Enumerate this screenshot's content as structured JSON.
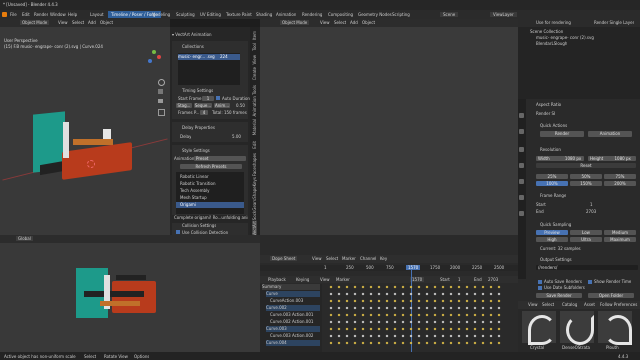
{
  "window": {
    "title": "* [Unsaved] - Blender 4.4.3"
  },
  "menus": [
    "File",
    "Edit",
    "Render",
    "Window",
    "Help"
  ],
  "workspaces": [
    "Layout",
    "Modeling",
    "Sculpting",
    "UV Editing",
    "Texture Paint",
    "Shading",
    "Animation",
    "Rendering",
    "Compositing",
    "Geometry Nodes",
    "Scripting"
  ],
  "active_workspace": "Timeline / Poser / Forge",
  "scene": {
    "label": "Scene",
    "view_layer": "ViewLayer"
  },
  "top_right_buttons": [
    "Use for rendering",
    "Render Single Layer"
  ],
  "viewport": {
    "header": [
      "Object Mode",
      "View",
      "Select",
      "Add",
      "Object"
    ],
    "shading_label": "Global",
    "overlay_text1": "User Perspective",
    "overlay_text2": "(15) F.B music- engrape- conr (2).svg | Curve.024"
  },
  "vector_panel": {
    "title": "VectArt Animation",
    "collections_label": "Collections",
    "collection_item": "music- engr... .svg",
    "collection_count": "224",
    "timing_label": "Timing Settings",
    "start_frame_label": "Start Frame",
    "start_frame_value": "1",
    "auto_duration": "Auto Duration",
    "stag_label": "Stag...",
    "seque_label": "Seque...",
    "anim_label": "Anim...",
    "anim_value": "0.50",
    "frames_label": "Frames P...",
    "frames_value": "4",
    "total_frames": "Total: 150 frames",
    "delay_label": "Delay Properties",
    "delay_field": "Delay",
    "delay_value": "5.00",
    "style_label": "Style Settings",
    "animation_field": "Animation",
    "animation_value": "Preset",
    "refresh": "Refresh Presets",
    "presets": [
      "Robotic Linear",
      "Robotic Transition",
      "Tech Assembly",
      "Mesh Startup",
      "Origami"
    ],
    "complete_text": "Complete origami! Ro...unfolding animation",
    "collision_label": "Collision Settings",
    "use_collision": "Use Collision Detection"
  },
  "side_tabs": [
    "Item",
    "Tool",
    "View",
    "Create",
    "Animation Tools",
    "Material",
    "Edit",
    "Faceshapes",
    "ShapeKeys",
    "SockGears",
    "VectArt"
  ],
  "outliner": {
    "title": "Scene Collection",
    "items": [
      "music- engrape- conr (2).svg",
      "BlendarLSlough"
    ]
  },
  "properties": {
    "aspect_ratio": "Aspect Ratio",
    "render_label": "Render SI",
    "quick_actions": "Quick Actions",
    "render_btn": "Render",
    "animation_btn": "Animation",
    "resolution_label": "Resolution",
    "width_label": "Width",
    "width_value": "1080 px",
    "height_label": "Height",
    "height_value": "1080 px",
    "percent_row1": [
      "25%",
      "50%",
      "75%"
    ],
    "percent_row2": [
      "100%",
      "150%",
      "200%"
    ],
    "reset": "Reset",
    "frame_range": "Frame Range",
    "start_label": "Start",
    "start_value": "1",
    "end_label": "End",
    "end_value": "2703",
    "quick_sampling": "Quick Sampling",
    "sampling_row1": [
      "Preview",
      "Low",
      "Medium"
    ],
    "sampling_row2": [
      "High",
      "Ultra",
      "Maximum"
    ],
    "current_samples": "Current: 32 samples",
    "output_settings": "Output Settings",
    "output_path": "//renders/",
    "auto_save": "Auto Save Renders",
    "show_time": "Show Render Time",
    "use_subfolders": "Use Date Subfolders",
    "save_render": "Save Render",
    "open_folder": "Open Folder"
  },
  "timeline": {
    "header": [
      "Dope Sheet",
      "View",
      "Select",
      "Marker",
      "Channel",
      "Key"
    ],
    "playback": [
      "Playback",
      "Keying",
      "View",
      "Marker"
    ],
    "current_frame": "1570",
    "start_label": "Start",
    "start_value": "1",
    "end_label": "End",
    "end_value": "2703",
    "ticks": [
      "1",
      "250",
      "500",
      "750",
      "1000",
      "1250",
      "1570",
      "1750",
      "2000",
      "2250",
      "2500"
    ],
    "channels": [
      "Summary",
      "Curve",
      "CurveAction.003",
      "Curve.002",
      "Curve.003 Action.001",
      "Curve.002 Action.001",
      "Curve.003",
      "Curve.003 Action.002",
      "Curve.004"
    ]
  },
  "asset_browser": {
    "tabs": [
      "View",
      "Select",
      "Catalog",
      "Asset",
      "Follow Preferences"
    ],
    "items": [
      "Crystal",
      "DenseOStrata",
      "Plouth"
    ]
  },
  "status": {
    "left": "Active object has non-uniform scale",
    "mid1": "Select",
    "mid2": "Rotate View",
    "mid3": "Options",
    "version": "4.4.3"
  }
}
